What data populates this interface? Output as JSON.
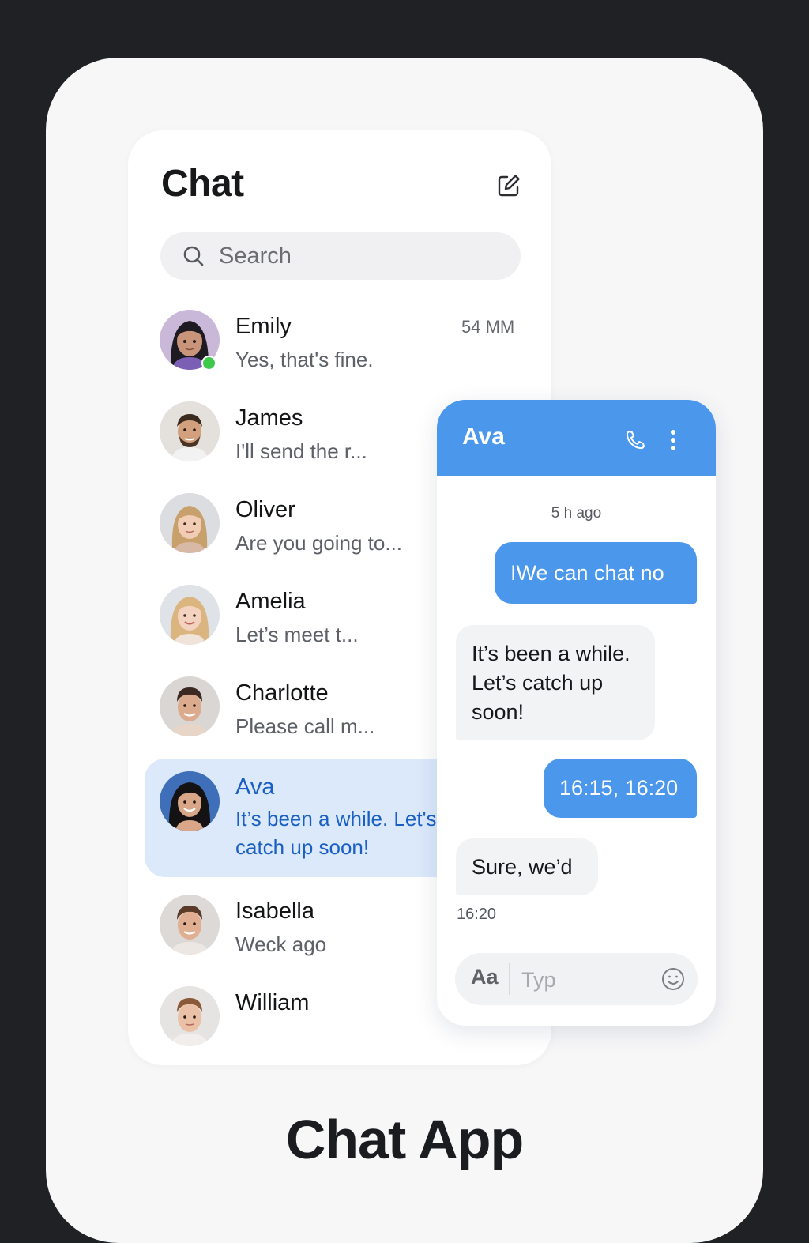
{
  "app_title": "Chat App",
  "list": {
    "title": "Chat",
    "compose_icon": "compose-icon",
    "search": {
      "placeholder": "Search",
      "icon": "search-icon"
    },
    "contacts": [
      {
        "name": "Emily",
        "message": "Yes, that's fine.",
        "time": "54 MM",
        "online": true
      },
      {
        "name": "James",
        "message": "I'll send the r..."
      },
      {
        "name": "Oliver",
        "message": "Are you going to..."
      },
      {
        "name": "Amelia",
        "message": "Let’s meet t..."
      },
      {
        "name": "Charlotte",
        "message": "Please call m..."
      },
      {
        "name": "Ava",
        "message": "It’s been a while. Let's catch up soon!",
        "active": true
      },
      {
        "name": "Isabella",
        "message": "Weck ago"
      },
      {
        "name": "William",
        "message": ""
      }
    ]
  },
  "conversation": {
    "contact_name": "Ava",
    "header_icons": [
      "phone-icon",
      "more-vertical-icon"
    ],
    "timestamp_top": "5 h ago",
    "messages": [
      {
        "direction": "out",
        "text": "IWe can chat no"
      },
      {
        "direction": "in",
        "text": "It’s been a while. Let’s catch up soon!"
      },
      {
        "direction": "out",
        "text": "16:15,  16:20"
      },
      {
        "direction": "in",
        "text": "Sure, we’d"
      }
    ],
    "timestamp_bottom": "16:20",
    "composer": {
      "format_label": "Aa",
      "placeholder": "Typ",
      "emoji_icon": "smiley-icon"
    }
  },
  "colors": {
    "background": "#1f2125",
    "card": "#f7f7f8",
    "accent": "#4a97ec",
    "active_row": "#dbe9fb",
    "active_text": "#1a5fc4",
    "online": "#3ec94a"
  }
}
